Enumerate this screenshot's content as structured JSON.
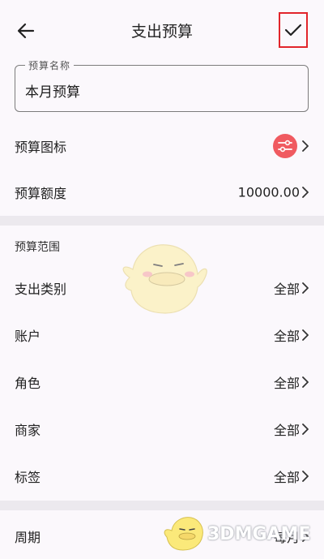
{
  "header": {
    "title": "支出预算",
    "back_icon": "arrow-left-icon",
    "confirm_icon": "check-icon"
  },
  "name_field": {
    "label": "预算名称",
    "value": "本月预算"
  },
  "icon_row": {
    "label": "预算图标",
    "icon": "sliders-icon",
    "icon_color": "#f05a60"
  },
  "amount_row": {
    "label": "预算额度",
    "value": "10000.00"
  },
  "scope": {
    "title": "预算范围",
    "rows": [
      {
        "label": "支出类别",
        "value": "全部"
      },
      {
        "label": "账户",
        "value": "全部"
      },
      {
        "label": "角色",
        "value": "全部"
      },
      {
        "label": "商家",
        "value": "全部"
      },
      {
        "label": "标签",
        "value": "全部"
      }
    ]
  },
  "period_row": {
    "label": "周期",
    "value": "每月"
  },
  "watermark": {
    "text": "3DMGAME"
  },
  "colors": {
    "background": "#fbf8fc",
    "divider": "#ece9ee",
    "highlight_border": "#e2252b"
  }
}
